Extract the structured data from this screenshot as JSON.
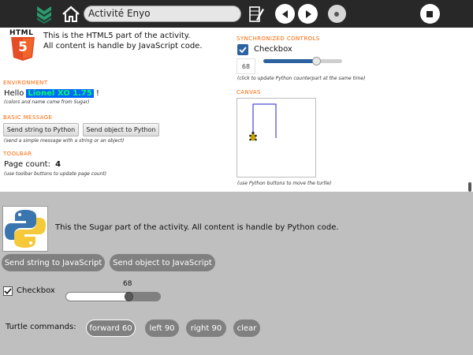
{
  "toolbar": {
    "title": "Activité Enyo",
    "icons": [
      "activity-icon",
      "home-icon",
      "notes-icon",
      "previous-icon",
      "next-icon",
      "page-dot-icon",
      "stop-icon"
    ]
  },
  "web": {
    "logo_text": "HTML",
    "logo_number": "5",
    "intro_line1": "This is the HTML5 part of the activity.",
    "intro_line2": "All content is handle by JavaScript code.",
    "environment": {
      "title": "ENVIRONMENT",
      "hello_prefix": "Hello",
      "name": "Lionel XO 1.75",
      "hello_suffix": "!",
      "note": "(colors and name come from Sugar)"
    },
    "basic_message": {
      "title": "BASIC MESSAGE",
      "send_string_label": "Send string to Python",
      "send_object_label": "Send object to Python",
      "note": "(send a simple message with a string or an object)"
    },
    "toolbar_section": {
      "title": "TOOLBAR",
      "page_count_label": "Page count:",
      "page_count_value": "4",
      "note": "(use toolbar buttons to update page count)"
    },
    "sync_controls": {
      "title": "SYNCHRONIZED CONTROLS",
      "checkbox_label": "Checkbox",
      "checked": true,
      "slider_value": "68",
      "note": "(click to update Python counterpart at the same time)"
    },
    "canvas": {
      "title": "CANVAS",
      "note": "(use Python buttons to move the turtle)"
    }
  },
  "sugar": {
    "intro": "This the Sugar part of the activity. All content is handle by Python code.",
    "send_string_label": "Send string to JavaScript",
    "send_object_label": "Send object to JavaScript",
    "checkbox_label": "Checkbox",
    "checked": true,
    "slider_value": "68",
    "turtle_label": "Turtle commands:",
    "turtle_buttons": [
      "forward 60",
      "left 90",
      "right 90",
      "clear"
    ]
  },
  "colors": {
    "toolbar_bg": "#282828",
    "section_title": "#ff6600",
    "name_bg": "#0066ff",
    "name_fg": "#00ff66",
    "sugar_bg": "#c0bfc0",
    "pill_bg": "#808080"
  }
}
